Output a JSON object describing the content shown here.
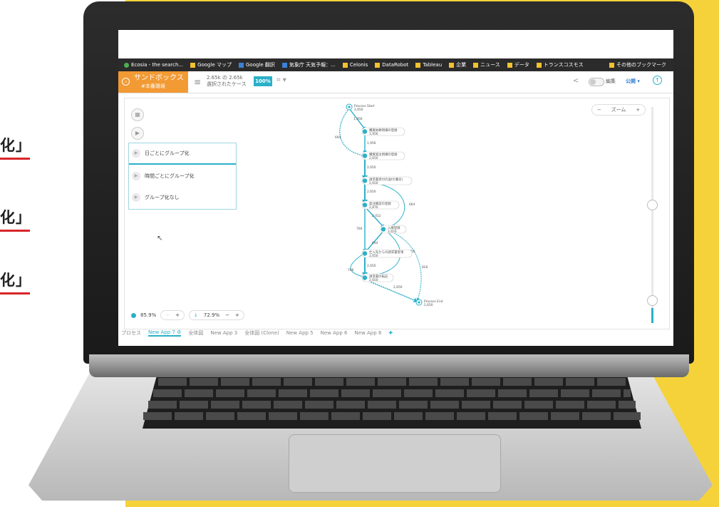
{
  "left_labels": [
    {
      "text": "化」"
    },
    {
      "text": "化」"
    },
    {
      "text": "化」"
    }
  ],
  "bookmarks": [
    {
      "label": "Ecosia - the search..."
    },
    {
      "label": "Google マップ"
    },
    {
      "label": "Google 翻訳"
    },
    {
      "label": "気象庁 天気予報：..."
    },
    {
      "label": "Celonis"
    },
    {
      "label": "DataRobot"
    },
    {
      "label": "Tableau"
    },
    {
      "label": "企業"
    },
    {
      "label": "ニュース"
    },
    {
      "label": "データ"
    },
    {
      "label": "トランスコスモス"
    }
  ],
  "bookmarks_other": "その他のブックマーク",
  "header": {
    "sandbox_title": "サンドボックス",
    "sandbox_sub": "#本番環境",
    "cases_line1": "2.65k の 2.65k",
    "cases_line2": "選択されたケース",
    "percent": "100%",
    "edit": "編集",
    "publish": "公開",
    "zoom_label": "ズーム"
  },
  "grouping": [
    {
      "label": "日ごとにグループ化"
    },
    {
      "label": "時間ごとにグループ化"
    },
    {
      "label": "グループ化なし"
    }
  ],
  "process": {
    "start": {
      "label": "Process Start",
      "count": "2,650"
    },
    "end": {
      "label": "Process End",
      "count": "2,650"
    },
    "nodes": [
      {
        "label": "購買依頼明細の登録",
        "count": "1,956"
      },
      {
        "label": "購買発注明細の登録",
        "count": "2,650"
      },
      {
        "label": "請求書受付の送付(署名)",
        "count": "2,650"
      },
      {
        "label": "発注確認の登録",
        "count": "2,876"
      },
      {
        "label": "入庫登録",
        "count": "2,650"
      },
      {
        "label": "仕入先からの請求書受領",
        "count": "2,650"
      },
      {
        "label": "請求書の転記",
        "count": "2,650"
      }
    ],
    "edge_labels": [
      "1,956",
      "694",
      "1,956",
      "2,650",
      "2,650",
      "664",
      "2,012",
      "766",
      "694",
      "1,956",
      "2,650",
      "826",
      "706",
      "2,650"
    ]
  },
  "bottom": {
    "activities_pct": "85.9%",
    "connections_pct": "72.9%"
  },
  "tabs": [
    {
      "label": "プロセス",
      "active": false
    },
    {
      "label": "New App 7",
      "active": true
    },
    {
      "label": "全体図",
      "active": false
    },
    {
      "label": "New App 3",
      "active": false
    },
    {
      "label": "全体図 (Clone)",
      "active": false
    },
    {
      "label": "New App 5",
      "active": false
    },
    {
      "label": "New App 6",
      "active": false
    },
    {
      "label": "New App 8",
      "active": false
    }
  ],
  "colors": {
    "accent": "#2ab0c8",
    "sandbox": "#f29a34",
    "background": "#f6d23a",
    "underline": "#d9252a"
  }
}
